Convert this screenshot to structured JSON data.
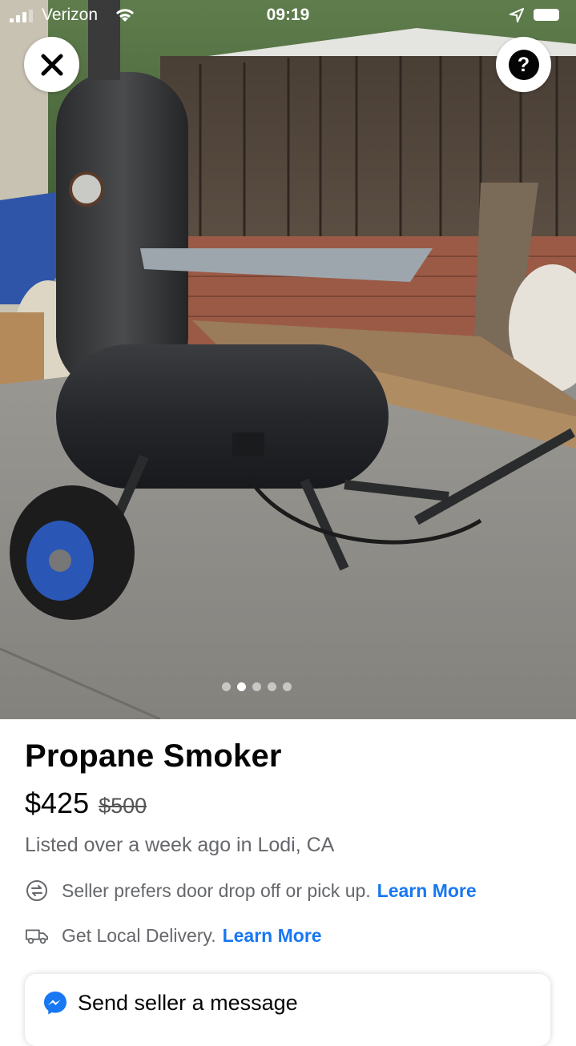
{
  "status_bar": {
    "carrier": "Verizon",
    "time": "09:19",
    "icons": [
      "signal-icon",
      "wifi-icon",
      "location-arrow-icon",
      "battery-icon"
    ]
  },
  "photo": {
    "description_icon": "listing-photo",
    "carousel": {
      "total": 5,
      "active_index": 1
    }
  },
  "overlay_buttons": {
    "close_icon": "close-icon",
    "help_label": "?"
  },
  "listing": {
    "title": "Propane Smoker",
    "price": "$425",
    "original_price": "$500",
    "listed_text": "Listed over a week ago in Lodi, CA"
  },
  "pickup": {
    "text": "Seller prefers door drop off or pick up.",
    "link": "Learn More",
    "icon": "swap-arrows-icon"
  },
  "delivery": {
    "text": "Get Local Delivery.",
    "link": "Learn More",
    "icon": "delivery-truck-icon"
  },
  "message_card": {
    "title": "Send seller a message",
    "icon": "messenger-icon"
  },
  "colors": {
    "link": "#1877f2",
    "secondary_text": "#65676b",
    "primary_text": "#050505"
  }
}
